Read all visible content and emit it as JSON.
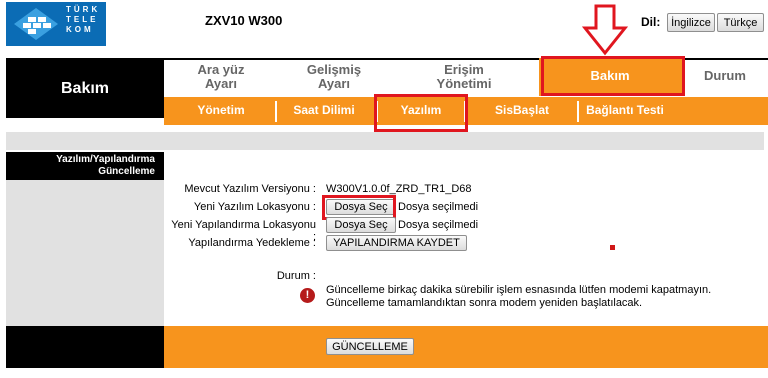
{
  "header": {
    "logo_lines": [
      "TÜRK",
      "TELE",
      "KOM"
    ],
    "model": "ZXV10 W300",
    "language_label": "Dil:",
    "languages": [
      "İngilizce",
      "Türkçe"
    ]
  },
  "nav": {
    "section_title": "Bakım",
    "items": [
      {
        "line1": "Ara yüz",
        "line2": "Ayarı"
      },
      {
        "line1": "Gelişmiş",
        "line2": "Ayarı"
      },
      {
        "line1": "Erişim",
        "line2": "Yönetimi"
      },
      {
        "line1": "Bakım",
        "line2": ""
      },
      {
        "line1": "Durum",
        "line2": ""
      }
    ],
    "active_index": 3
  },
  "subnav": {
    "items": [
      "Yönetim",
      "Saat Dilimi",
      "Yazılım",
      "SisBaşlat",
      "Bağlantı Testi"
    ],
    "active_index": 2
  },
  "side": {
    "title_line1": "Yazılım/Yapılandırma",
    "title_line2": "Güncelleme"
  },
  "form": {
    "firmware_label": "Mevcut Yazılım Versiyonu",
    "firmware_value": "W300V1.0.0f_ZRD_TR1_D68",
    "firmware_location_label": "Yeni Yazılım Lokasyonu",
    "config_location_label": "Yeni Yapılandırma Lokasyonu",
    "backup_label": "Yapılandırma Yedekleme",
    "choose_file": "Dosya Seç",
    "no_file": "Dosya seçilmedi",
    "backup_button": "YAPILANDIRMA KAYDET",
    "status_label": "Durum",
    "status_message": "Güncelleme birkaç dakika sürebilir işlem esnasında lütfen modemi kapatmayın. Güncelleme tamamlandıktan sonra modem yeniden başlatılacak."
  },
  "footer": {
    "update_button": "GÜNCELLEME"
  },
  "colors": {
    "orange": "#f7941d",
    "highlight_red": "#e0161f",
    "brand_blue": "#0b6cb5"
  }
}
